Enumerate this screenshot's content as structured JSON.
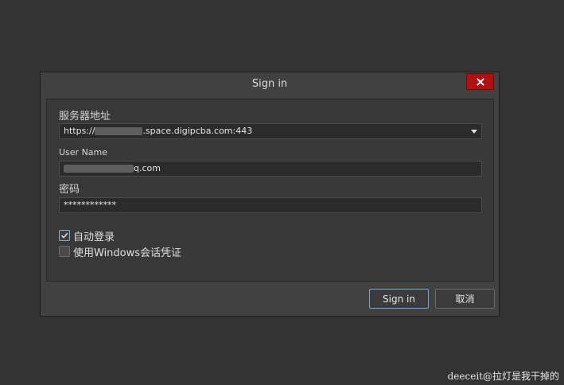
{
  "dialog": {
    "title": "Sign in",
    "close_icon": "close-icon",
    "server": {
      "label": "服务器地址",
      "value_prefix": "https://",
      "value_suffix": ".space.digipcba.com:443"
    },
    "username": {
      "label": "User Name",
      "value_suffix": "q.com"
    },
    "password": {
      "label": "密码",
      "value": "************"
    },
    "auto_login": {
      "label": "自动登录",
      "checked": true
    },
    "windows_cred": {
      "label": "使用Windows会话凭证",
      "checked": false
    },
    "buttons": {
      "signin": "Sign in",
      "cancel": "取消"
    }
  },
  "watermark": "deeceit@拉灯是我干掉的",
  "colors": {
    "close": "#b01010",
    "focus": "#7aa6d2"
  }
}
